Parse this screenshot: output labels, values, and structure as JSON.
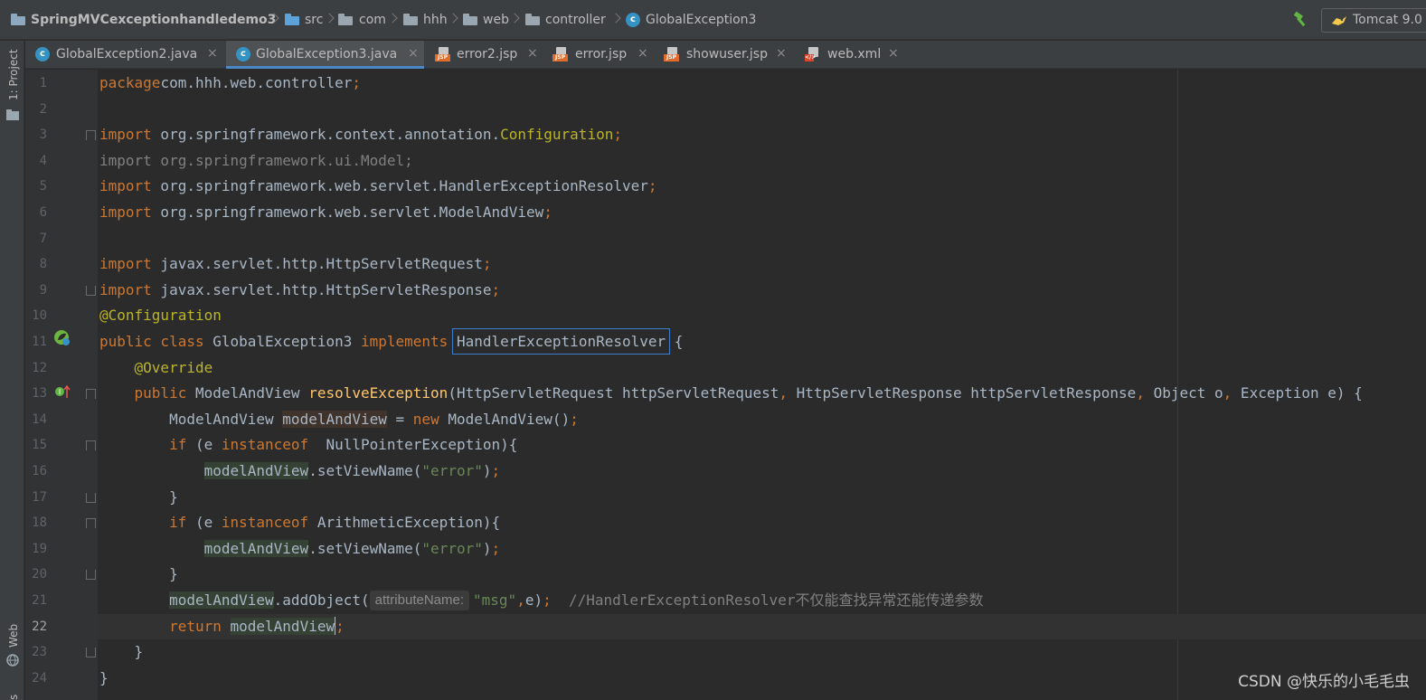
{
  "breadcrumb": {
    "project": "SpringMVCexceptionhandledemo3",
    "items": [
      "src",
      "com",
      "hhh",
      "web",
      "controller"
    ],
    "file": "GlobalException3"
  },
  "run_config": {
    "label": "Tomcat 9.0"
  },
  "tool_stripe": {
    "top_label": "1: Project",
    "bottom_label": "Web",
    "bottom_label2": "s"
  },
  "tabs": [
    {
      "label": "GlobalException2.java",
      "type": "java",
      "active": false
    },
    {
      "label": "GlobalException3.java",
      "type": "java",
      "active": true
    },
    {
      "label": "error2.jsp",
      "type": "jsp",
      "active": false
    },
    {
      "label": "error.jsp",
      "type": "jsp",
      "active": false
    },
    {
      "label": "showuser.jsp",
      "type": "jsp",
      "active": false
    },
    {
      "label": "web.xml",
      "type": "xml",
      "active": false
    }
  ],
  "tab_close": "×",
  "editor": {
    "current_line": 22,
    "lines": [
      [
        [
          "kw",
          "package"
        ],
        [
          "",
          "com.hhh.web.controller"
        ],
        [
          "kw",
          ";"
        ]
      ],
      [],
      [
        [
          "kw",
          "import"
        ],
        [
          "",
          " org.springframework.context.annotation."
        ],
        [
          "ann",
          "Configuration"
        ],
        [
          "kw",
          ";"
        ]
      ],
      [
        [
          "unused",
          "import org.springframework.ui.Model;"
        ]
      ],
      [
        [
          "kw",
          "import"
        ],
        [
          "",
          " org.springframework.web.servlet.HandlerExceptionResolver"
        ],
        [
          "kw",
          ";"
        ]
      ],
      [
        [
          "kw",
          "import"
        ],
        [
          "",
          " org.springframework.web.servlet.ModelAndView"
        ],
        [
          "kw",
          ";"
        ]
      ],
      [],
      [
        [
          "kw",
          "import"
        ],
        [
          "",
          " javax.servlet.http.HttpServletRequest"
        ],
        [
          "kw",
          ";"
        ]
      ],
      [
        [
          "kw",
          "import"
        ],
        [
          "",
          " javax.servlet.http.HttpServletResponse"
        ],
        [
          "kw",
          ";"
        ]
      ],
      [
        [
          "ann",
          "@Configuration"
        ]
      ],
      [
        [
          "kw",
          "public class"
        ],
        [
          "",
          " GlobalException3 "
        ],
        [
          "kw",
          "implements"
        ],
        [
          "",
          " "
        ],
        [
          "boxed",
          "HandlerExceptionResolver"
        ],
        [
          "",
          " {"
        ]
      ],
      [
        [
          "",
          "    "
        ],
        [
          "ann",
          "@Override"
        ]
      ],
      [
        [
          "",
          "    "
        ],
        [
          "kw",
          "public"
        ],
        [
          "",
          " ModelAndView "
        ],
        [
          "fn",
          "resolveException"
        ],
        [
          "",
          "(HttpServletRequest httpServletRequest"
        ],
        [
          "kw",
          ","
        ],
        [
          "",
          " HttpServletResponse httpServletResponse"
        ],
        [
          "kw",
          ","
        ],
        [
          "",
          " Object o"
        ],
        [
          "kw",
          ","
        ],
        [
          "",
          " Exception e) {"
        ]
      ],
      [
        [
          "",
          "        ModelAndView "
        ],
        [
          "hl2",
          "modelAndView"
        ],
        [
          "",
          " = "
        ],
        [
          "kw",
          "new"
        ],
        [
          "",
          " ModelAndView()"
        ],
        [
          "kw",
          ";"
        ]
      ],
      [
        [
          "",
          "        "
        ],
        [
          "kw",
          "if"
        ],
        [
          "",
          " (e "
        ],
        [
          "kw",
          "instanceof"
        ],
        [
          "",
          "  NullPointerException){"
        ]
      ],
      [
        [
          "",
          "            "
        ],
        [
          "hl",
          "modelAndView"
        ],
        [
          "",
          ".setViewName("
        ],
        [
          "str",
          "\"error\""
        ],
        [
          "",
          ")"
        ],
        [
          "kw",
          ";"
        ]
      ],
      [
        [
          "",
          "        }"
        ]
      ],
      [
        [
          "",
          "        "
        ],
        [
          "kw",
          "if"
        ],
        [
          "",
          " (e "
        ],
        [
          "kw",
          "instanceof"
        ],
        [
          "",
          " ArithmeticException){"
        ]
      ],
      [
        [
          "",
          "            "
        ],
        [
          "hl",
          "modelAndView"
        ],
        [
          "",
          ".setViewName("
        ],
        [
          "str",
          "\"error\""
        ],
        [
          "",
          ")"
        ],
        [
          "kw",
          ";"
        ]
      ],
      [
        [
          "",
          "        }"
        ]
      ],
      [
        [
          "",
          "        "
        ],
        [
          "hl",
          "modelAndView"
        ],
        [
          "",
          ".addObject("
        ],
        [
          "hint",
          "attributeName:"
        ],
        [
          "str",
          "\"msg\""
        ],
        [
          "kw",
          ","
        ],
        [
          "",
          "e)"
        ],
        [
          "kw",
          ";"
        ],
        [
          "",
          "  "
        ],
        [
          "cmt",
          "//HandlerExceptionResolver不仅能查找异常还能传递参数"
        ]
      ],
      [
        [
          "",
          "        "
        ],
        [
          "kw",
          "return"
        ],
        [
          "",
          " "
        ],
        [
          "hl",
          "modelAndView"
        ],
        [
          "caret",
          ""
        ],
        [
          "kw",
          ";"
        ]
      ],
      [
        [
          "",
          "    }"
        ]
      ],
      [
        [
          "",
          "}"
        ]
      ]
    ]
  },
  "watermark": "CSDN @快乐的小毛毛虫",
  "colors": {
    "keyword": "#cc7832",
    "annotation": "#bbb529",
    "method": "#ffc66d",
    "string": "#6a8759",
    "comment": "#808080",
    "accent": "#4a88c7"
  }
}
